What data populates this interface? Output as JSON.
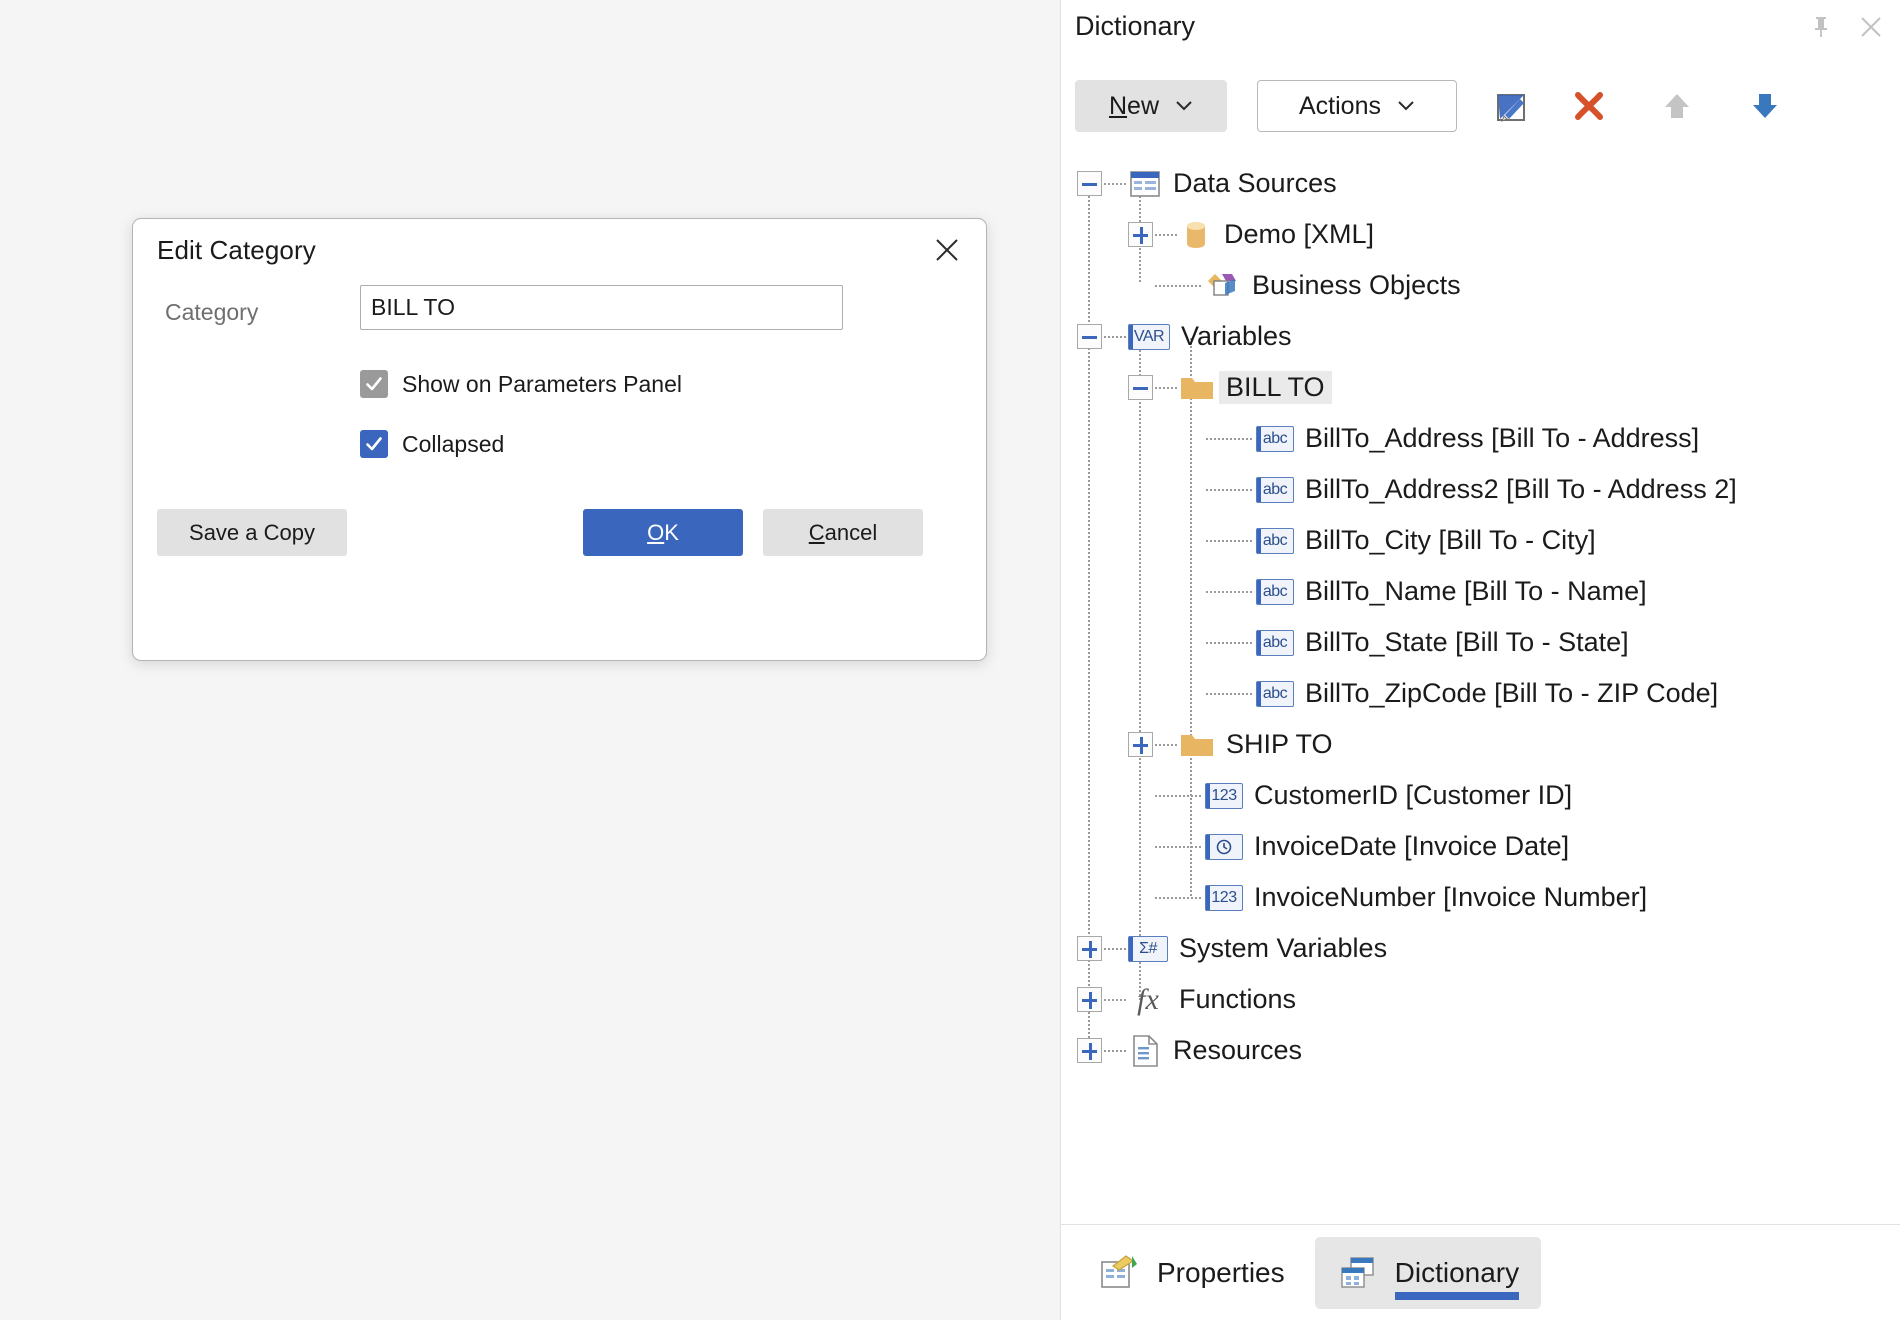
{
  "dialog": {
    "title": "Edit Category",
    "close_icon": "close-icon",
    "category_label": "Category",
    "category_value": "BILL TO",
    "category_placeholder": "",
    "checkboxes": [
      {
        "label": "Show on Parameters Panel",
        "checked": true,
        "state": "disabled",
        "color": "#9a9a9a"
      },
      {
        "label": "Collapsed",
        "checked": true,
        "state": "enabled",
        "color": "#3a67bd"
      }
    ],
    "buttons": {
      "save_copy": "Save a Copy",
      "ok_accel": "O",
      "ok_rest": "K",
      "cancel_accel": "C",
      "cancel_rest": "ancel"
    }
  },
  "panel": {
    "title": "Dictionary",
    "pin_icon": "pin-icon",
    "close_icon": "close-icon",
    "toolbar": {
      "new_accel": "N",
      "new_rest": "ew",
      "actions": "Actions",
      "edit_icon": "edit-icon",
      "delete_icon": "delete-x-icon",
      "move_up_icon": "arrow-up-icon",
      "move_down_icon": "arrow-down-icon"
    },
    "tree": [
      {
        "label": "Data Sources",
        "icon": "data-sources-icon",
        "expander": "minus",
        "depth": 0,
        "selected": false
      },
      {
        "label": "Demo [XML]",
        "icon": "database-cylinder-icon",
        "expander": "plus",
        "depth": 1,
        "selected": false
      },
      {
        "label": "Business Objects",
        "icon": "business-objects-icon",
        "expander": "none",
        "depth": 1,
        "selected": false
      },
      {
        "label": "Variables",
        "icon": "var-badge-icon",
        "expander": "minus",
        "depth": 0,
        "selected": false
      },
      {
        "label": "BILL TO",
        "icon": "folder-icon",
        "expander": "minus",
        "depth": 1,
        "selected": true
      },
      {
        "label": "BillTo_Address [Bill To - Address]",
        "icon": "abc-badge-icon",
        "expander": "none",
        "depth": 2,
        "selected": false
      },
      {
        "label": "BillTo_Address2 [Bill To - Address 2]",
        "icon": "abc-badge-icon",
        "expander": "none",
        "depth": 2,
        "selected": false
      },
      {
        "label": "BillTo_City [Bill To - City]",
        "icon": "abc-badge-icon",
        "expander": "none",
        "depth": 2,
        "selected": false
      },
      {
        "label": "BillTo_Name [Bill To - Name]",
        "icon": "abc-badge-icon",
        "expander": "none",
        "depth": 2,
        "selected": false
      },
      {
        "label": "BillTo_State [Bill To - State]",
        "icon": "abc-badge-icon",
        "expander": "none",
        "depth": 2,
        "selected": false
      },
      {
        "label": "BillTo_ZipCode [Bill To - ZIP Code]",
        "icon": "abc-badge-icon",
        "expander": "none",
        "depth": 2,
        "selected": false
      },
      {
        "label": "SHIP TO",
        "icon": "folder-icon",
        "expander": "plus",
        "depth": 1,
        "selected": false
      },
      {
        "label": "CustomerID [Customer ID]",
        "icon": "number-badge-icon",
        "expander": "none",
        "depth": 1,
        "selected": false
      },
      {
        "label": "InvoiceDate [Invoice Date]",
        "icon": "date-badge-icon",
        "expander": "none",
        "depth": 1,
        "selected": false
      },
      {
        "label": "InvoiceNumber [Invoice Number]",
        "icon": "number-badge-icon",
        "expander": "none",
        "depth": 1,
        "selected": false
      },
      {
        "label": "System Variables",
        "icon": "sigma-hash-badge-icon",
        "expander": "plus",
        "depth": 0,
        "selected": false
      },
      {
        "label": "Functions",
        "icon": "fx-icon",
        "expander": "plus",
        "depth": 0,
        "selected": false
      },
      {
        "label": "Resources",
        "icon": "document-icon",
        "expander": "plus",
        "depth": 0,
        "selected": false
      }
    ],
    "badge_text": {
      "var": "VAR",
      "abc": "abc",
      "number": "123",
      "sigma": "Σ#",
      "fx": "fx"
    },
    "tabs": [
      {
        "label": "Properties",
        "icon": "properties-icon",
        "active": false
      },
      {
        "label": "Dictionary",
        "icon": "dictionary-icon",
        "active": true
      }
    ]
  },
  "colors": {
    "accent_blue": "#3a67bd",
    "folder_yellow": "#e8b563",
    "delete_red": "#d6502a",
    "disabled_gray": "#c4c4c4"
  }
}
